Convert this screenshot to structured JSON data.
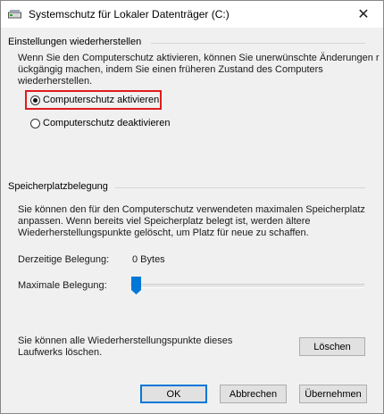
{
  "window": {
    "title": "Systemschutz für Lokaler Datenträger (C:)"
  },
  "restore": {
    "group_title": "Einstellungen wiederherstellen",
    "description": [
      "Wenn Sie den Computerschutz aktivieren, können Sie unerwünschte Änderungen r",
      "ückgängig machen, indem Sie einen früheren Zustand des Computers",
      "wiederherstellen."
    ],
    "options": [
      {
        "label": "Computerschutz aktivieren",
        "selected": true
      },
      {
        "label": "Computerschutz deaktivieren",
        "selected": false
      }
    ]
  },
  "storage": {
    "group_title": "Speicherplatzbelegung",
    "description": [
      "Sie können den für den Computerschutz verwendeten maximalen Speicherplatz",
      "anpassen. Wenn bereits viel Speicherplatz belegt ist, werden ältere",
      "Wiederherstellungspunkte gelöscht, um Platz für neue zu schaffen."
    ],
    "current_label": "Derzeitige Belegung:",
    "current_value": "0 Bytes",
    "max_label": "Maximale Belegung:",
    "max_level_percent": 0
  },
  "delete_section": {
    "text": [
      "Sie können alle Wiederherstellungspunkte dieses",
      "Laufwerks löschen."
    ],
    "delete_label": "Löschen"
  },
  "buttons": {
    "ok": "OK",
    "cancel": "Abbrechen",
    "apply": "Übernehmen"
  },
  "colors": {
    "accent": "#0078d7",
    "highlight": "#e01b1b"
  }
}
